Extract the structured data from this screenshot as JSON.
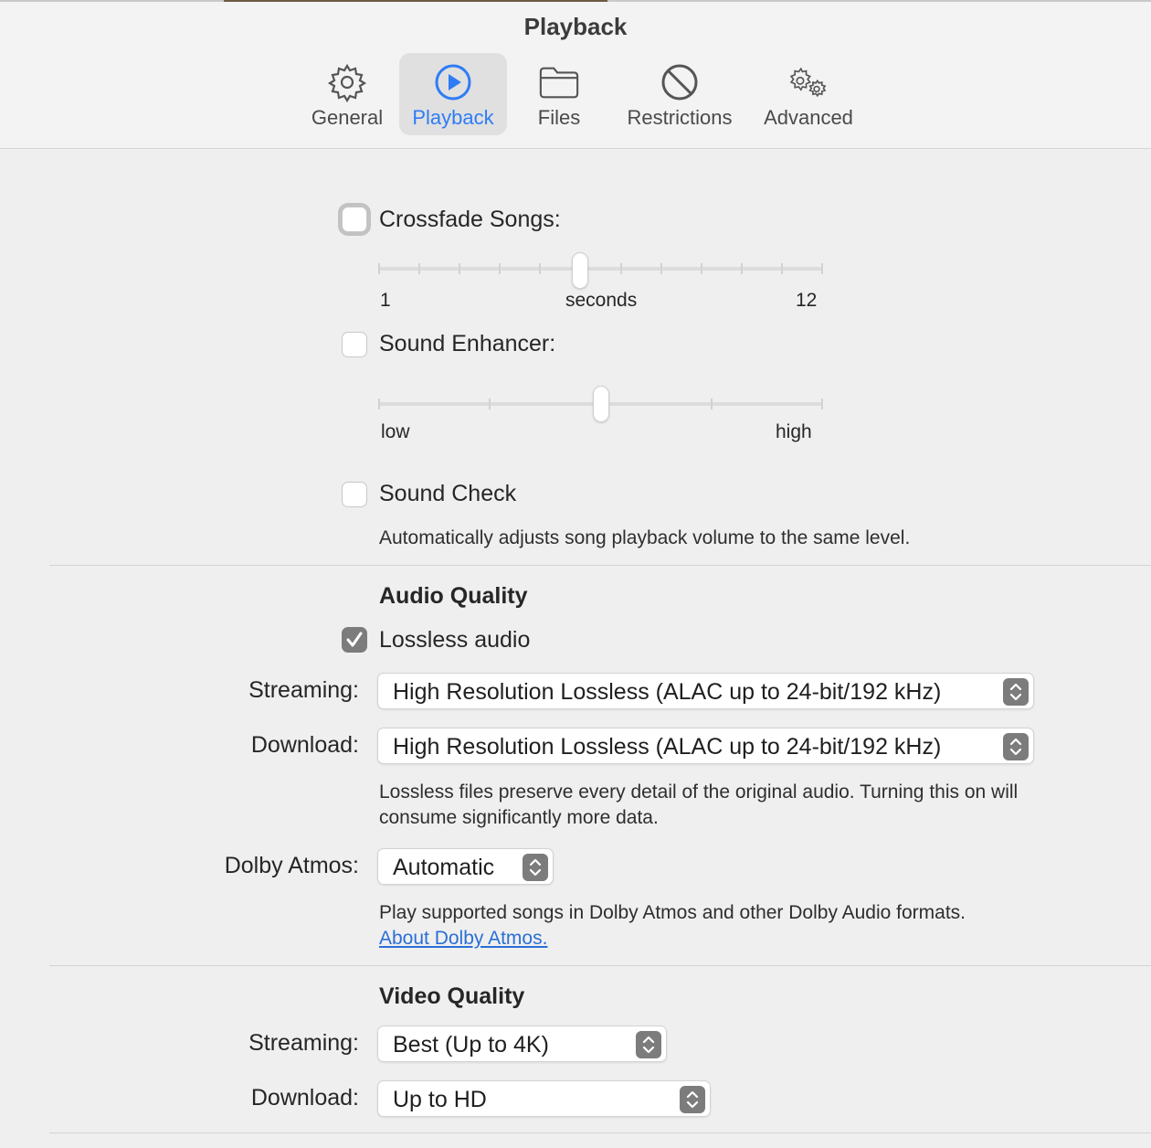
{
  "window": {
    "title": "Playback"
  },
  "tabs": [
    {
      "label": "General",
      "icon": "gear-icon"
    },
    {
      "label": "Playback",
      "icon": "play-circle-icon",
      "active": true
    },
    {
      "label": "Files",
      "icon": "folder-icon"
    },
    {
      "label": "Restrictions",
      "icon": "prohibited-icon"
    },
    {
      "label": "Advanced",
      "icon": "gears-icon"
    }
  ],
  "crossfade": {
    "label": "Crossfade Songs:",
    "checked": false,
    "min_label": "1",
    "unit_label": "seconds",
    "max_label": "12",
    "min": 1,
    "max": 12,
    "value": 6
  },
  "sound_enhancer": {
    "label": "Sound Enhancer:",
    "checked": false,
    "low_label": "low",
    "high_label": "high",
    "value_fraction": 0.5
  },
  "sound_check": {
    "label": "Sound Check",
    "checked": false,
    "description": "Automatically adjusts song playback volume to the same level."
  },
  "audio_quality": {
    "heading": "Audio Quality",
    "lossless": {
      "label": "Lossless audio",
      "checked": true
    },
    "streaming": {
      "label": "Streaming:",
      "value": "High Resolution Lossless (ALAC up to 24-bit/192 kHz)"
    },
    "download": {
      "label": "Download:",
      "value": "High Resolution Lossless (ALAC up to 24-bit/192 kHz)"
    },
    "lossless_note": "Lossless files preserve every detail of the original audio. Turning this on will consume significantly more data.",
    "dolby": {
      "label": "Dolby Atmos:",
      "value": "Automatic",
      "note": "Play supported songs in Dolby Atmos and other Dolby Audio formats.",
      "link": "About Dolby Atmos."
    }
  },
  "video_quality": {
    "heading": "Video Quality",
    "streaming": {
      "label": "Streaming:",
      "value": "Best (Up to 4K)"
    },
    "download": {
      "label": "Download:",
      "value": "Up to HD"
    }
  },
  "colors": {
    "accent": "#2f7cf6",
    "link": "#2a6fd6",
    "checkbox_checked": "#7c7c7c"
  }
}
